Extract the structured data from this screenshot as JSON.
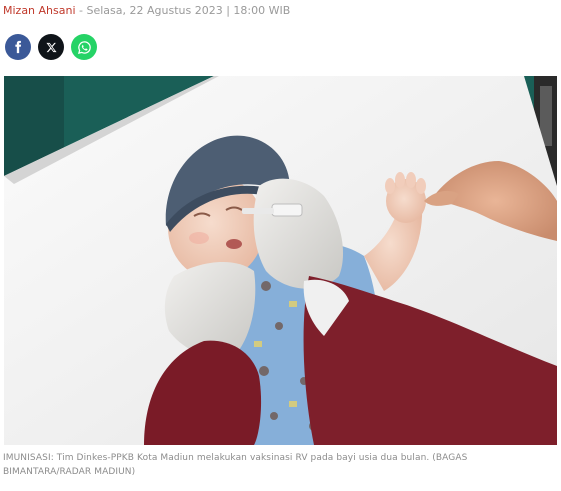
{
  "article": {
    "author": "Mizan Ahsani",
    "separator": " - ",
    "datetime": "Selasa, 22 Agustus 2023 | 18:00 WIB"
  },
  "share": {
    "buttons": [
      {
        "name": "facebook",
        "icon": "facebook-icon",
        "color": "#3b5998"
      },
      {
        "name": "x",
        "icon": "x-icon",
        "color": "#0f1419"
      },
      {
        "name": "whatsapp",
        "icon": "whatsapp-icon",
        "color": "#25d366"
      }
    ]
  },
  "photo": {
    "caption": "IMUNISASI: Tim Dinkes-PPKB Kota Madiun melakukan vaksinasi RV pada bayi usia dua bulan. (BAGAS BIMANTARA/RADAR MADIUN)"
  }
}
